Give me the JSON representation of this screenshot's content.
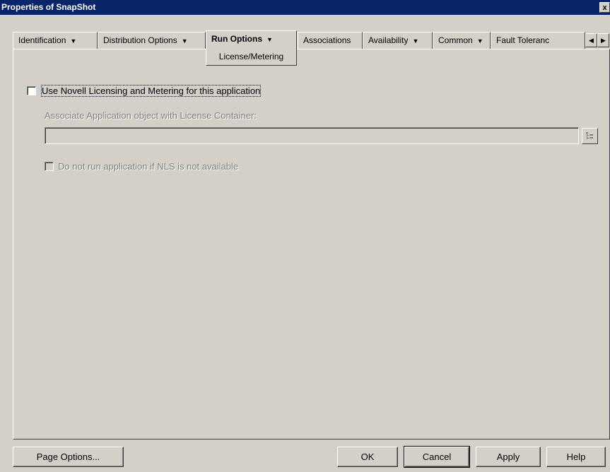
{
  "window": {
    "title": "Properties of SnapShot",
    "close_glyph": "x"
  },
  "tabs": [
    {
      "label": "Identification",
      "has_dropdown": true
    },
    {
      "label": "Distribution Options",
      "has_dropdown": true
    },
    {
      "label": "Run Options",
      "has_dropdown": true,
      "active": true
    },
    {
      "label": "Associations",
      "has_dropdown": false
    },
    {
      "label": "Availability",
      "has_dropdown": true
    },
    {
      "label": "Common",
      "has_dropdown": true
    },
    {
      "label": "Fault Toleranc",
      "has_dropdown": false
    }
  ],
  "active_subtab": "License/Metering",
  "tab_dropdown_glyph": "▼",
  "tab_scroll": {
    "left_glyph": "◀",
    "right_glyph": "▶"
  },
  "content": {
    "use_licensing": {
      "label": "Use Novell Licensing and Metering for this application",
      "checked": false
    },
    "associate_label": "Associate Application object with License Container:",
    "container_value": "",
    "do_not_run": {
      "label": "Do not run application if NLS is not available",
      "checked": false
    }
  },
  "buttons": {
    "page_options": "Page Options...",
    "ok": "OK",
    "cancel": "Cancel",
    "apply": "Apply",
    "help": "Help"
  }
}
